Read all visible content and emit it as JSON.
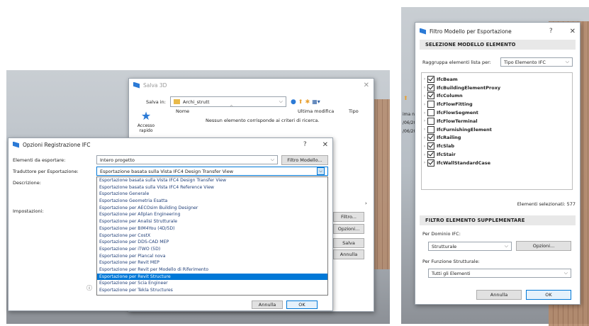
{
  "save_dialog": {
    "title": "Salva 3D",
    "save_in_label": "Salva in:",
    "save_in_value": "Archi_strutt",
    "quick_access": "Accesso rapido",
    "col_name": "Nome",
    "col_modified": "Ultima modifica",
    "col_type": "Tipo",
    "empty_message": "Nessun elemento corrisponde ai criteri di ricerca.",
    "filter_button": "Filtro...",
    "options_button": "Opzioni...",
    "save_button": "Salva",
    "cancel_button": "Annulla"
  },
  "ifc_dialog": {
    "title": "Opzioni Registrazione IFC",
    "help": "?",
    "close": "✕",
    "elements_label": "Elementi da esportare:",
    "elements_value": "Intero progetto",
    "filter_model_button": "Filtro Modello...",
    "translator_label": "Traduttore per Esportazione:",
    "translator_value": "Esportazione basata sulla Vista IFC4 Design Transfer View",
    "description_label": "Descrizione:",
    "settings_label": "Impostazioni:",
    "translator_options": [
      "Esportazione basata sulla Vista IFC4 Design Transfer View",
      "Esportazione basata sulla Vista IFC4 Reference View",
      "Esportazione Generale",
      "Esportazione Geometria Esatta",
      "Esportazione per AECOsim Building Designer",
      "Esportazione per Allplan Engineering",
      "Esportazione per Analisi Strutturale",
      "Esportazione per BIM4You (4D/5D)",
      "Esportazione per CostX",
      "Esportazione per DDS-CAD MEP",
      "Esportazione per iTWO (5D)",
      "Esportazione per Plancal nova",
      "Esportazione per Revit MEP",
      "Esportazione per Revit per Modello di Riferimento",
      "Esportazione per Revit Structure",
      "Esportazione per Scia Engineer",
      "Esportazione per Tekla Structures"
    ],
    "selected_index": 14,
    "cancel_button": "Annulla",
    "ok_button": "OK"
  },
  "bg_fragments": {
    "col_ima": "ima n",
    "date1": "/06/20",
    "date2": "/06/20"
  },
  "filter_dialog": {
    "title": "Filtro Modello per Esportazione",
    "help": "?",
    "close": "✕",
    "section_selection": "SELEZIONE MODELLO ELEMENTO",
    "group_label": "Raggruppa elementi lista per:",
    "group_value": "Tipo Elemento IFC",
    "tree_items": [
      {
        "label": "IfcBeam",
        "checked": true
      },
      {
        "label": "IfcBuildingElementProxy",
        "checked": true
      },
      {
        "label": "IfcColumn",
        "checked": true
      },
      {
        "label": "IfcFlowFitting",
        "checked": false
      },
      {
        "label": "IfcFlowSegment",
        "checked": false
      },
      {
        "label": "IfcFlowTerminal",
        "checked": false
      },
      {
        "label": "IfcFurnishingElement",
        "checked": false
      },
      {
        "label": "IfcRailing",
        "checked": true
      },
      {
        "label": "IfcSlab",
        "checked": true
      },
      {
        "label": "IfcStair",
        "checked": true
      },
      {
        "label": "IfcWallStandardCase",
        "checked": true
      }
    ],
    "selected_count": "Elementi selezionati: 577",
    "section_extra": "FILTRO ELEMENTO SUPPLEMENTARE",
    "domain_label": "Per Dominio IFC:",
    "domain_value": "Strutturale",
    "domain_options_button": "Opzioni...",
    "function_label": "Per Funzione Strutturale:",
    "function_value": "Tutti gli Elementi",
    "cancel_button": "Annulla",
    "ok_button": "OK"
  }
}
